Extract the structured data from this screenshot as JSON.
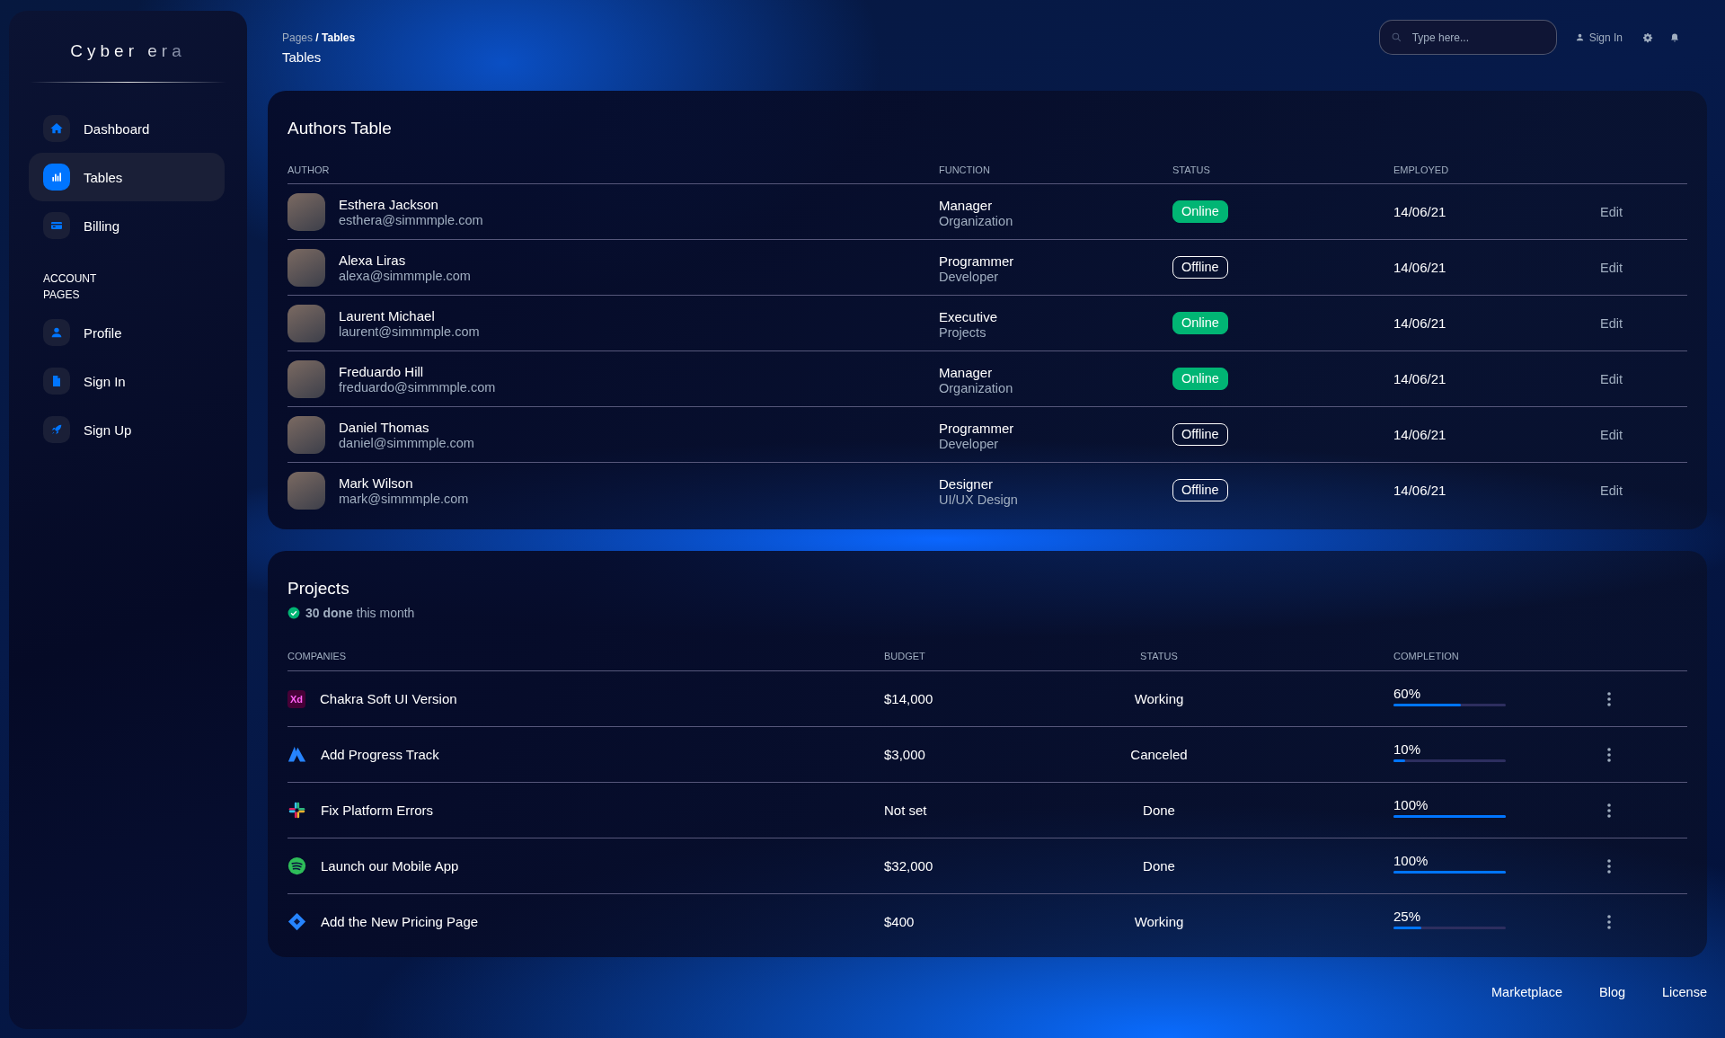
{
  "sidebar": {
    "logo": "Cyber era",
    "items": [
      {
        "label": "Dashboard",
        "kind": "home",
        "selected": false
      },
      {
        "label": "Tables",
        "kind": "chart",
        "selected": true
      },
      {
        "label": "Billing",
        "kind": "card",
        "selected": false
      }
    ],
    "section_title": "ACCOUNT PAGES",
    "account_items": [
      {
        "label": "Profile",
        "kind": "person",
        "selected": false
      },
      {
        "label": "Sign In",
        "kind": "document",
        "selected": false
      },
      {
        "label": "Sign Up",
        "kind": "rocket",
        "selected": false
      }
    ]
  },
  "top_bar": {
    "breadcrumb": "Pages **/ Tables**",
    "title": "Tables",
    "search": {
      "placeholder": "Type here..."
    },
    "sign_in": "Sign In"
  },
  "authors": {
    "title": "Authors Table",
    "columns": [
      "AUTHOR",
      "FUNCTION",
      "STATUS",
      "EMPLOYED"
    ],
    "rows": [
      {
        "name": "Esthera Jackson",
        "email": "esthera@simmmple.com",
        "function": "Manager",
        "department": "Organization",
        "status": "Online",
        "online": true,
        "employed": "14/06/21",
        "action": "Edit"
      },
      {
        "name": "Alexa Liras",
        "email": "alexa@simmmple.com",
        "function": "Programmer",
        "department": "Developer",
        "status": "Offline",
        "online": false,
        "employed": "14/06/21",
        "action": "Edit"
      },
      {
        "name": "Laurent Michael",
        "email": "laurent@simmmple.com",
        "function": "Executive",
        "department": "Projects",
        "status": "Online",
        "online": true,
        "employed": "14/06/21",
        "action": "Edit"
      },
      {
        "name": "Freduardo Hill",
        "email": "freduardo@simmmple.com",
        "function": "Manager",
        "department": "Organization",
        "status": "Online",
        "online": true,
        "employed": "14/06/21",
        "action": "Edit"
      },
      {
        "name": "Daniel Thomas",
        "email": "daniel@simmmple.com",
        "function": "Programmer",
        "department": "Developer",
        "status": "Offline",
        "online": false,
        "employed": "14/06/21",
        "action": "Edit"
      },
      {
        "name": "Mark Wilson",
        "email": "mark@simmmple.com",
        "function": "Designer",
        "department": "UI/UX Design",
        "status": "Offline",
        "online": false,
        "employed": "14/06/21",
        "action": "Edit"
      }
    ]
  },
  "projects": {
    "title": "Projects",
    "summary": "**30 done** this month",
    "columns": [
      "COMPANIES",
      "BUDGET",
      "STATUS",
      "COMPLETION"
    ],
    "rows": [
      {
        "kind": "xd",
        "logo_text": "Xd",
        "name": "Chakra Soft UI Version",
        "budget": "$14,000",
        "status": "Working",
        "completion": "60%",
        "level": 0.6
      },
      {
        "kind": "triangle",
        "name": "Add Progress Track",
        "budget": "$3,000",
        "status": "Canceled",
        "completion": "10%",
        "level": 0.1
      },
      {
        "kind": "pinwheel",
        "name": "Fix Platform Errors",
        "budget": "Not set",
        "status": "Done",
        "completion": "100%",
        "level": 1
      },
      {
        "kind": "waves",
        "name": "Launch our Mobile App",
        "budget": "$32,000",
        "status": "Done",
        "completion": "100%",
        "level": 1
      },
      {
        "kind": "diamond",
        "name": "Add the New Pricing Page",
        "budget": "$400",
        "status": "Working",
        "completion": "25%",
        "level": 0.25
      }
    ]
  },
  "footer": {
    "links": [
      "Marketplace",
      "Blog",
      "License"
    ]
  }
}
